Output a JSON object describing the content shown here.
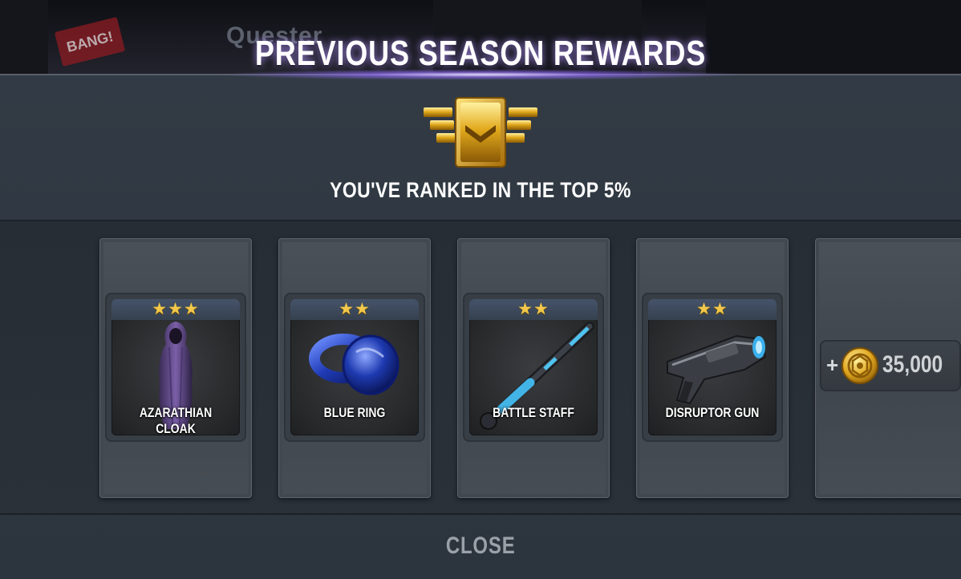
{
  "background": {
    "badge_text": "BANG!",
    "hero_name": "Quester"
  },
  "header": {
    "title": "PREVIOUS SEASON REWARDS",
    "rank_message": "YOU'VE RANKED IN THE TOP 5%",
    "rank_icon": "gold-rank-chevron-icon"
  },
  "rewards": [
    {
      "name": "AZARATHIAN CLOAK",
      "stars": 3,
      "stars_text": "★★★",
      "icon": "hooded-cloak-icon"
    },
    {
      "name": "BLUE RING",
      "stars": 2,
      "stars_text": "★★",
      "icon": "blue-ring-icon"
    },
    {
      "name": "BATTLE STAFF",
      "stars": 2,
      "stars_text": "★★",
      "icon": "battle-staff-icon"
    },
    {
      "name": "DISRUPTOR GUN",
      "stars": 2,
      "stars_text": "★★",
      "icon": "disruptor-gun-icon"
    }
  ],
  "credits": {
    "prefix": "+",
    "amount": "35,000",
    "icon": "gold-coin-icon"
  },
  "footer": {
    "close_label": "CLOSE"
  },
  "colors": {
    "star_gold": "#f3c84a",
    "title_glow": "#a080ff",
    "panel": "#2b333c"
  }
}
